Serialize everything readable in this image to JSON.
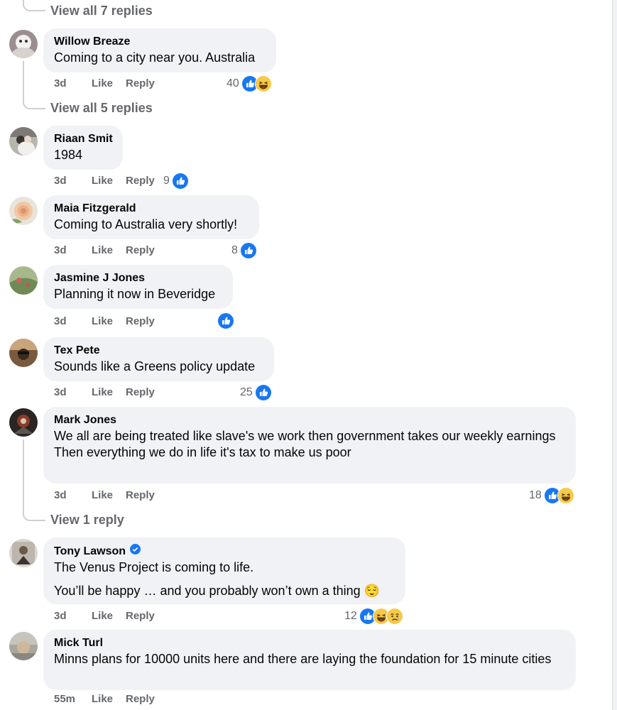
{
  "comments": [
    {
      "author": "Willow Breaze",
      "lines": [
        "Coming to a city near you. Australia"
      ],
      "time": "3d",
      "like": "Like",
      "reply": "Reply",
      "reaction_count": "40",
      "reactions": [
        "like-icon",
        "haha-icon"
      ]
    },
    {
      "author": "Riaan Smit",
      "lines": [
        "1984"
      ],
      "time": "3d",
      "like": "Like",
      "reply": "Reply",
      "reaction_count": "9",
      "reactions": [
        "like-icon"
      ]
    },
    {
      "author": "Maia Fitzgerald",
      "lines": [
        "Coming to Australia very shortly!"
      ],
      "time": "3d",
      "like": "Like",
      "reply": "Reply",
      "reaction_count": "8",
      "reactions": [
        "like-icon"
      ]
    },
    {
      "author": "Jasmine J Jones",
      "lines": [
        "Planning it now in Beveridge"
      ],
      "time": "3d",
      "like": "Like",
      "reply": "Reply",
      "reaction_count": "",
      "reactions": [
        "like-icon"
      ]
    },
    {
      "author": "Tex Pete",
      "lines": [
        "Sounds like a Greens policy update"
      ],
      "time": "3d",
      "like": "Like",
      "reply": "Reply",
      "reaction_count": "25",
      "reactions": [
        "like-icon"
      ]
    },
    {
      "author": "Mark Jones",
      "lines": [
        "We all are being treated like slave's we work then government takes our weekly earnings",
        "Then everything we do in life it's tax to make us poor"
      ],
      "time": "3d",
      "like": "Like",
      "reply": "Reply",
      "reaction_count": "18",
      "reactions": [
        "like-icon",
        "haha-icon"
      ]
    },
    {
      "author": "Tony Lawson",
      "verified": true,
      "lines": [
        "The Venus Project is coming to life.",
        "You’ll be happy … and you probably won’t own a thing 😌"
      ],
      "time": "3d",
      "like": "Like",
      "reply": "Reply",
      "reaction_count": "12",
      "reactions": [
        "like-icon",
        "haha-icon",
        "sad-icon"
      ]
    },
    {
      "author": "Mick Turl",
      "lines": [
        "Minns plans for 10000 units here and there are laying the foundation for 15 minute cities"
      ],
      "time": "55m",
      "like": "Like",
      "reply": "Reply",
      "reaction_count": "",
      "reactions": []
    }
  ],
  "view_replies": [
    "View all 7 replies",
    "View all 5 replies",
    "View 1 reply"
  ],
  "colors": {
    "bubble": "#f0f2f5",
    "muted": "#65676b",
    "like_blue": "#1877f2",
    "haha_yellow": "#f7c948"
  }
}
